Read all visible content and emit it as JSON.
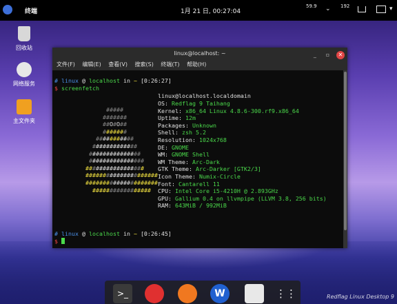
{
  "topbar": {
    "app_name": "终端",
    "clock": "1月 21 日, 00:27:04",
    "net_down": "59.9",
    "net_up": "192"
  },
  "desktop": {
    "icons": [
      {
        "label": "回收站",
        "icon": "trash-icon"
      },
      {
        "label": "网络服务",
        "icon": "network-icon"
      },
      {
        "label": "主文件夹",
        "icon": "home-folder-icon"
      }
    ]
  },
  "terminal": {
    "title": "linux@localhost: ~",
    "menu": [
      "文件(F)",
      "编辑(E)",
      "查看(V)",
      "搜索(S)",
      "终端(T)",
      "帮助(H)"
    ],
    "prompt1": {
      "user": "linux",
      "host": "localhost",
      "dir": "~",
      "time": "[0:26:27]"
    },
    "command": "screenfetch",
    "info_header": "linux@localhost.localdomain",
    "info": [
      {
        "k": "OS:",
        "v": "Redflag 9 Taihang"
      },
      {
        "k": "Kernel:",
        "v": "x86_64 Linux 4.8.6-300.rf9.x86_64"
      },
      {
        "k": "Uptime:",
        "v": "12m"
      },
      {
        "k": "Packages:",
        "v": "Unknown"
      },
      {
        "k": "Shell:",
        "v": "zsh 5.2"
      },
      {
        "k": "Resolution:",
        "v": "1024x768"
      },
      {
        "k": "DE:",
        "v": "GNOME"
      },
      {
        "k": "WM:",
        "v": "GNOME Shell"
      },
      {
        "k": "WM Theme:",
        "v": "Arc-Dark"
      },
      {
        "k": "GTK Theme:",
        "v": "Arc-Darker [GTK2/3]"
      },
      {
        "k": "Icon Theme:",
        "v": "Numix-Circle"
      },
      {
        "k": "Font:",
        "v": "Cantarell 11"
      },
      {
        "k": "CPU:",
        "v": "Intel Core i5-4210H @ 2.893GHz"
      },
      {
        "k": "GPU:",
        "v": "Gallium 0.4 on llvmpipe (LLVM 3.8, 256 bits)"
      },
      {
        "k": "RAM:",
        "v": "643MiB / 992MiB"
      }
    ],
    "prompt2": {
      "user": "linux",
      "host": "localhost",
      "dir": "~",
      "time": "[0:26:45]"
    }
  },
  "dock": {
    "items": [
      "terminal-icon",
      "music-icon",
      "firefox-icon",
      "wps-icon",
      "file-manager-icon",
      "app-grid-icon"
    ]
  },
  "watermark": "Redflag Linux Desktop 9"
}
